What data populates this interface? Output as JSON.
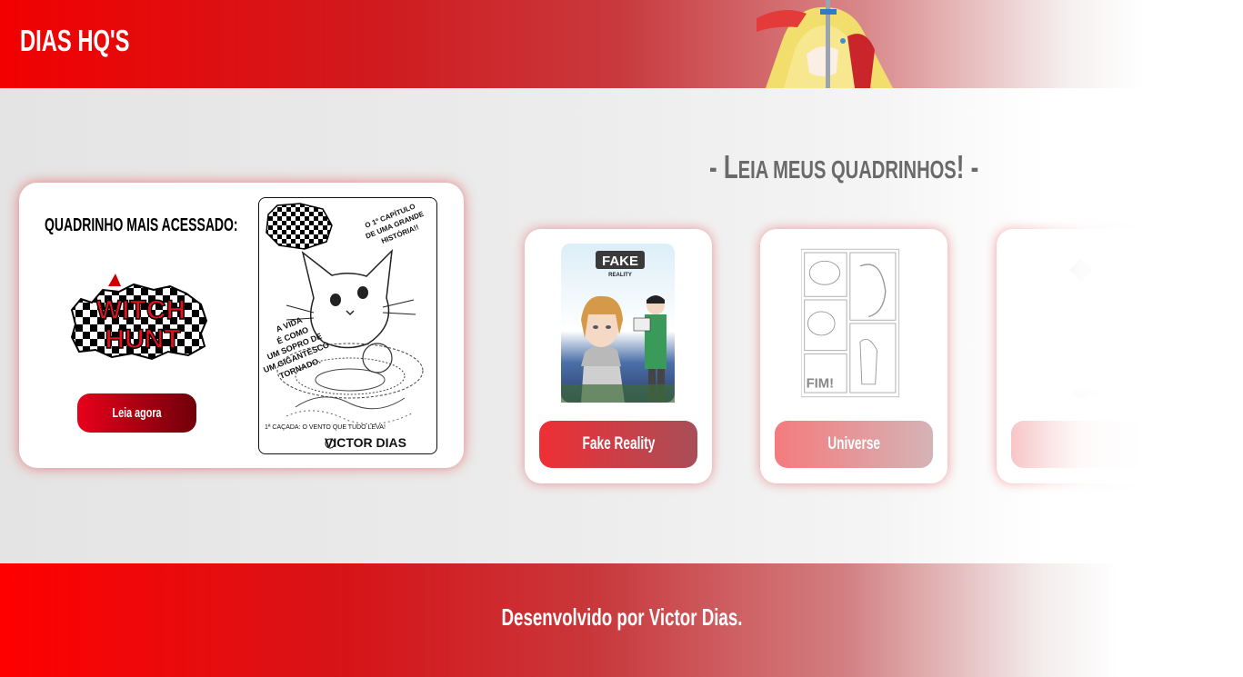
{
  "header": {
    "site_title": "DIAS HQ'S"
  },
  "section": {
    "title_prefix": "- ",
    "title_big_1": "L",
    "title_small_1": "EIA MEUS QUADRINHOS",
    "title_suffix": "! -"
  },
  "featured": {
    "label": "QUADRINHO MAIS ACESSADO:",
    "logo_text": "WITCH HUNT",
    "button_label": "Leia agora",
    "cover": {
      "caption_top": "O 1º CAPÍTULO DE UMA GRANDE HISTÓRIA!!",
      "caption_left": "A VIDA É COMO UM SOPRO DE UM GIGANTESCO TORNADO.",
      "caption_bottom": "1ª CAÇADA: O VENTO QUE TUDO LEVA!",
      "author": "VICTOR DIAS"
    }
  },
  "comics": [
    {
      "button_label": "Fake Reality",
      "logo": "FAKE",
      "logo_sub": "REALITY"
    },
    {
      "button_label": "Universe",
      "end_text": "FIM!"
    },
    {
      "button_label": ""
    }
  ],
  "footer": {
    "credit": "Desenvolvido por Victor Dias."
  },
  "colors": {
    "brand_red": "#f20000",
    "dark_red": "#70000a",
    "section_gray": "#6a6a6a"
  }
}
